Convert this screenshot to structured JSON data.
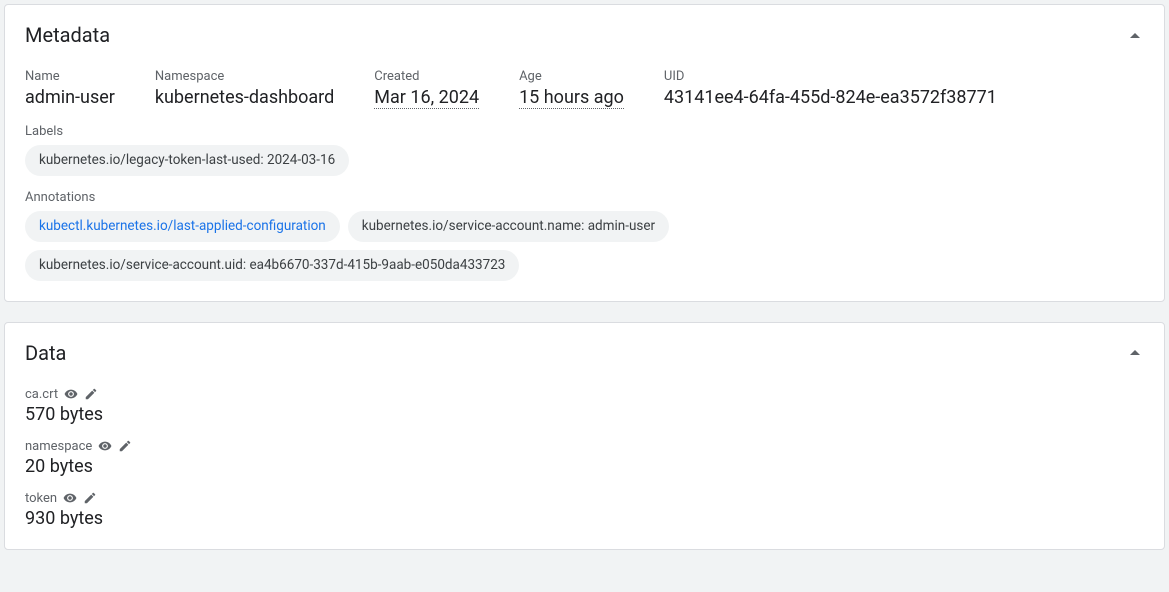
{
  "metadata": {
    "title": "Metadata",
    "fields": {
      "name_label": "Name",
      "name_value": "admin-user",
      "namespace_label": "Namespace",
      "namespace_value": "kubernetes-dashboard",
      "created_label": "Created",
      "created_value": "Mar 16, 2024",
      "age_label": "Age",
      "age_value": "15 hours ago",
      "uid_label": "UID",
      "uid_value": "43141ee4-64fa-455d-824e-ea3572f38771"
    },
    "labels_label": "Labels",
    "labels": [
      "kubernetes.io/legacy-token-last-used: 2024-03-16"
    ],
    "annotations_label": "Annotations",
    "annotations": [
      {
        "text": "kubectl.kubernetes.io/last-applied-configuration",
        "link": true
      },
      {
        "text": "kubernetes.io/service-account.name: admin-user",
        "link": false
      },
      {
        "text": "kubernetes.io/service-account.uid: ea4b6670-337d-415b-9aab-e050da433723",
        "link": false
      }
    ]
  },
  "data": {
    "title": "Data",
    "items": [
      {
        "key": "ca.crt",
        "value": "570 bytes"
      },
      {
        "key": "namespace",
        "value": "20 bytes"
      },
      {
        "key": "token",
        "value": "930 bytes"
      }
    ]
  }
}
